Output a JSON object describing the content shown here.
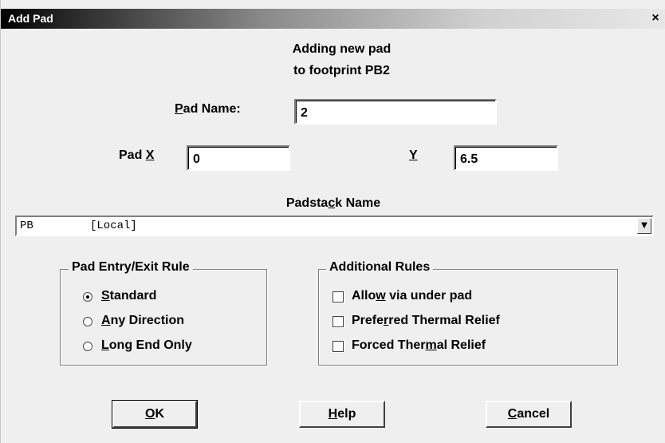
{
  "dialog": {
    "title": "Add Pad",
    "close_symbol": "×",
    "message_line1": "Adding new pad",
    "message_line2": "to footprint PB2"
  },
  "pad_name": {
    "label_mnemonic": "P",
    "label_rest": "ad Name:",
    "value": "2"
  },
  "pad_x": {
    "label_pre": "Pad ",
    "label_mnemonic": "X",
    "value": "0"
  },
  "pad_y": {
    "label_mnemonic": "Y",
    "value": "6.5"
  },
  "padstack": {
    "label_pre": "Padsta",
    "label_mnemonic": "c",
    "label_post": "k Name",
    "selected_name": "PB",
    "selected_scope": "[Local]",
    "arrow_icon": "▼"
  },
  "entry_rule": {
    "title": "Pad Entry/Exit Rule",
    "options": [
      {
        "mnemonic": "S",
        "rest": "tandard",
        "selected": true
      },
      {
        "mnemonic": "A",
        "rest": "ny Direction",
        "selected": false
      },
      {
        "mnemonic": "L",
        "rest": "ong End Only",
        "selected": false
      }
    ]
  },
  "additional_rules": {
    "title": "Additional Rules",
    "options": [
      {
        "pre": "Allo",
        "mnemonic": "w",
        "post": " via under pad",
        "checked": false
      },
      {
        "pre": "Prefe",
        "mnemonic": "r",
        "post": "red Thermal Relief",
        "checked": false
      },
      {
        "pre": "Forced Ther",
        "mnemonic": "m",
        "post": "al Relief",
        "checked": false
      }
    ]
  },
  "buttons": {
    "ok": {
      "mnemonic": "O",
      "rest": "K"
    },
    "help": {
      "mnemonic": "H",
      "rest": "elp"
    },
    "cancel": {
      "mnemonic": "C",
      "rest": "ancel"
    }
  }
}
